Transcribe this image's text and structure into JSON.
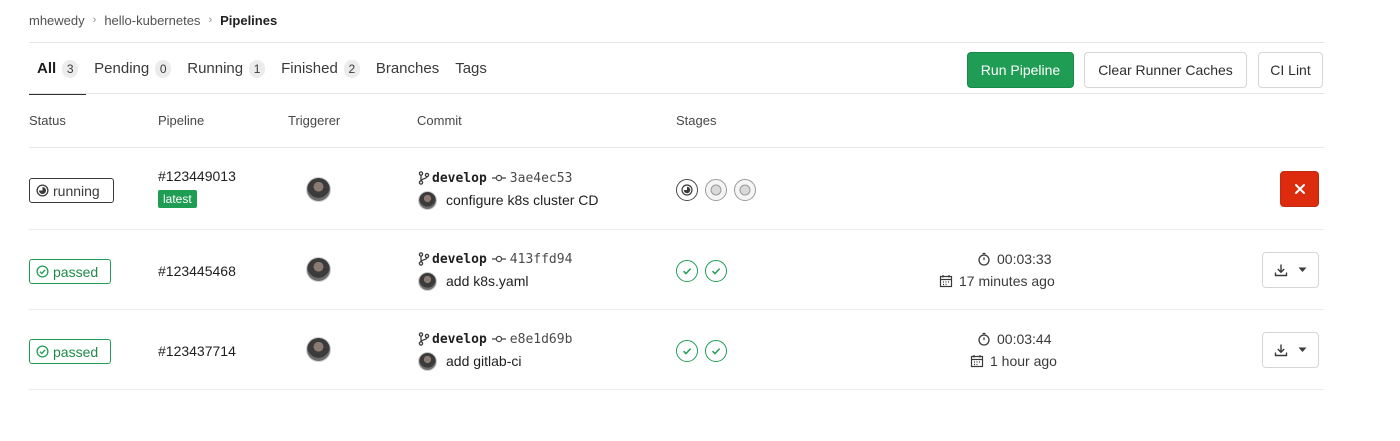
{
  "breadcrumb": {
    "user": "mhewedy",
    "project": "hello-kubernetes",
    "current": "Pipelines"
  },
  "tabs": [
    {
      "label": "All",
      "count": "3",
      "active": true
    },
    {
      "label": "Pending",
      "count": "0"
    },
    {
      "label": "Running",
      "count": "1"
    },
    {
      "label": "Finished",
      "count": "2"
    },
    {
      "label": "Branches"
    },
    {
      "label": "Tags"
    }
  ],
  "actions": {
    "run_pipeline": "Run Pipeline",
    "clear_caches": "Clear Runner Caches",
    "ci_lint": "CI Lint"
  },
  "columns": {
    "status": "Status",
    "pipeline": "Pipeline",
    "triggerer": "Triggerer",
    "commit": "Commit",
    "stages": "Stages"
  },
  "rows": [
    {
      "status": "running",
      "pipeline_id": "#123449013",
      "badge": "latest",
      "branch": "develop",
      "sha": "3ae4ec53",
      "message": "configure k8s cluster CD",
      "stages": [
        "running",
        "pending",
        "pending"
      ],
      "duration": "",
      "finished": "",
      "action": "cancel"
    },
    {
      "status": "passed",
      "pipeline_id": "#123445468",
      "branch": "develop",
      "sha": "413ffd94",
      "message": "add k8s.yaml",
      "stages": [
        "passed",
        "passed"
      ],
      "duration": "00:03:33",
      "finished": "17 minutes ago",
      "action": "download"
    },
    {
      "status": "passed",
      "pipeline_id": "#123437714",
      "branch": "develop",
      "sha": "e8e1d69b",
      "message": "add gitlab-ci",
      "stages": [
        "passed",
        "passed"
      ],
      "duration": "00:03:44",
      "finished": "1 hour ago",
      "action": "download"
    }
  ],
  "colors": {
    "primary_green": "#1f9d55",
    "danger_red": "#dd2b0e",
    "text": "#2e2e2e"
  }
}
